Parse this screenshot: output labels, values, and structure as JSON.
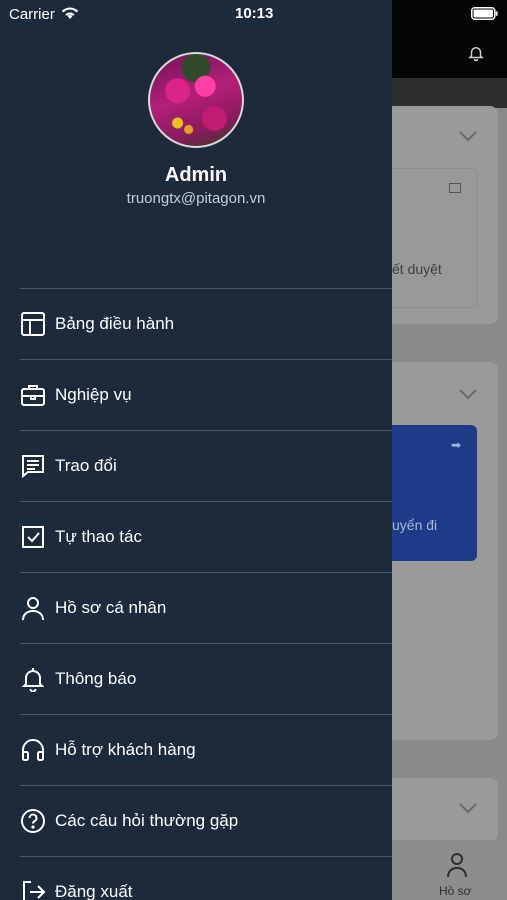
{
  "status_bar": {
    "carrier": "Carrier",
    "time": "10:13"
  },
  "profile": {
    "name": "Admin",
    "email": "truongtx@pitagon.vn"
  },
  "menu": {
    "items": [
      {
        "label": "Bảng điều hành",
        "icon": "dashboard-icon"
      },
      {
        "label": "Nghiệp vụ",
        "icon": "briefcase-icon"
      },
      {
        "label": "Trao đổi",
        "icon": "chat-icon"
      },
      {
        "label": "Tự thao tác",
        "icon": "checkbox-icon"
      },
      {
        "label": "Hồ sơ cá nhân",
        "icon": "user-icon"
      },
      {
        "label": "Thông báo",
        "icon": "bell-icon"
      },
      {
        "label": "Hỗ trợ khách hàng",
        "icon": "headset-icon"
      },
      {
        "label": "Các câu hỏi thường gặp",
        "icon": "help-circle-icon"
      },
      {
        "label": "Đăng xuất",
        "icon": "logout-icon"
      }
    ]
  },
  "background": {
    "card1_text": "ết duyệt",
    "card2_text": "uyển đi",
    "tab_label": "Hồ sơ"
  },
  "colors": {
    "drawer_bg": "#1d2a3c",
    "divider": "#4b5668",
    "accent_blue": "#1e3b8a",
    "text": "#ffffff"
  }
}
